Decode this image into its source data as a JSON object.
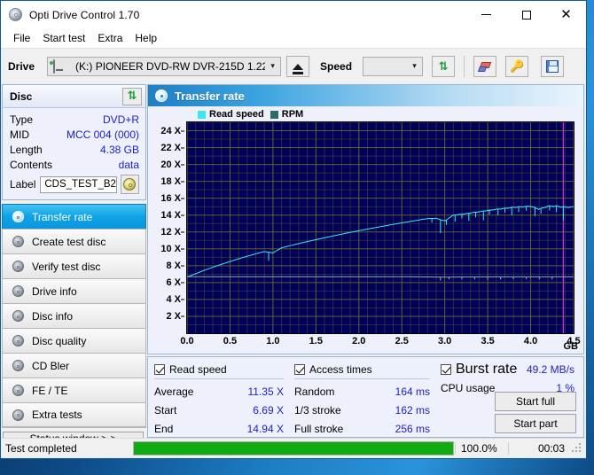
{
  "window": {
    "title": "Opti Drive Control 1.70",
    "app_icon": "disc-icon",
    "controls": {
      "minimize": "minimize-icon",
      "maximize": "maximize-icon",
      "close": "close-icon"
    }
  },
  "menubar": {
    "items": [
      "File",
      "Start test",
      "Extra",
      "Help"
    ]
  },
  "toolbar": {
    "drive_label": "Drive",
    "drive_value": "(K:)  PIONEER DVD-RW  DVR-215D 1.22",
    "eject_icon": "eject-icon",
    "speed_label": "Speed",
    "speed_value": "",
    "refresh_icon": "refresh-icon",
    "erase_icon": "eraser-icon",
    "tools_icon": "tools-icon",
    "save_icon": "save-icon"
  },
  "disc": {
    "header": "Disc",
    "refresh_icon": "refresh-icon",
    "rows": [
      {
        "key": "Type",
        "value": "DVD+R"
      },
      {
        "key": "MID",
        "value": "MCC 004 (000)"
      },
      {
        "key": "Length",
        "value": "4.38 GB"
      },
      {
        "key": "Contents",
        "value": "data"
      }
    ],
    "label_key": "Label",
    "label_value": "CDS_TEST_B2",
    "label_button_icon": "cd-icon"
  },
  "nav": {
    "items": [
      {
        "label": "Transfer rate",
        "icon": "disc-icon",
        "selected": true
      },
      {
        "label": "Create test disc",
        "icon": "disc-icon",
        "selected": false
      },
      {
        "label": "Verify test disc",
        "icon": "disc-icon",
        "selected": false
      },
      {
        "label": "Drive info",
        "icon": "disc-icon",
        "selected": false
      },
      {
        "label": "Disc info",
        "icon": "disc-icon",
        "selected": false
      },
      {
        "label": "Disc quality",
        "icon": "disc-icon",
        "selected": false
      },
      {
        "label": "CD Bler",
        "icon": "disc-icon",
        "selected": false
      },
      {
        "label": "FE / TE",
        "icon": "disc-icon",
        "selected": false
      },
      {
        "label": "Extra tests",
        "icon": "disc-icon",
        "selected": false
      }
    ],
    "status_window_button": "Status window > >"
  },
  "panel": {
    "title": "Transfer rate",
    "icon": "disc-icon"
  },
  "chart_data": {
    "type": "line",
    "title": "Transfer rate",
    "xlabel": "GB",
    "ylabel": "X",
    "xlim": [
      0.0,
      4.5
    ],
    "ylim": [
      0,
      25
    ],
    "xticks": [
      0.0,
      0.5,
      1.0,
      1.5,
      2.0,
      2.5,
      3.0,
      3.5,
      4.0,
      4.5
    ],
    "xticklabels": [
      "0.0",
      "0.5",
      "1.0",
      "1.5",
      "2.0",
      "2.5",
      "3.0",
      "3.5",
      "4.0",
      "4.5"
    ],
    "x_unit_label": "GB",
    "yticks": [
      2,
      4,
      6,
      8,
      10,
      12,
      14,
      16,
      18,
      20,
      22,
      24
    ],
    "yticklabels": [
      "2 X",
      "4 X",
      "6 X",
      "8 X",
      "10 X",
      "12 X",
      "14 X",
      "16 X",
      "18 X",
      "20 X",
      "22 X",
      "24 X"
    ],
    "grid": true,
    "background": "#00005a",
    "grid_color": "#6b6b1e",
    "legend_position": "top-left",
    "marker_line": {
      "x": 4.38,
      "color": "#cc33cc",
      "label": "disc end"
    },
    "series": [
      {
        "name": "Read speed",
        "color": "#3ce8f0",
        "x": [
          0.0,
          0.05,
          0.1,
          0.2,
          0.3,
          0.4,
          0.5,
          0.6,
          0.7,
          0.8,
          0.9,
          1.0,
          1.1,
          1.2,
          1.3,
          1.4,
          1.5,
          1.6,
          1.7,
          1.8,
          1.9,
          2.0,
          2.1,
          2.2,
          2.3,
          2.4,
          2.5,
          2.6,
          2.7,
          2.8,
          2.9,
          3.0,
          3.1,
          3.2,
          3.3,
          3.4,
          3.5,
          3.6,
          3.7,
          3.8,
          3.9,
          4.0,
          4.1,
          4.2,
          4.3,
          4.38
        ],
        "values": [
          6.69,
          6.85,
          7.05,
          7.45,
          7.82,
          8.16,
          8.5,
          8.82,
          9.12,
          9.41,
          9.68,
          9.52,
          10.12,
          10.38,
          10.62,
          10.86,
          11.09,
          11.31,
          11.53,
          11.74,
          11.95,
          12.15,
          12.34,
          12.53,
          12.72,
          12.9,
          13.08,
          13.25,
          13.42,
          13.59,
          13.62,
          13.3,
          14.0,
          14.1,
          14.25,
          14.4,
          14.55,
          14.68,
          14.8,
          14.92,
          14.99,
          15.05,
          14.7,
          15.05,
          15.06,
          14.94
        ]
      },
      {
        "name": "RPM",
        "color": "#8fb0b0",
        "x": [
          0.0,
          0.5,
          1.0,
          1.5,
          2.0,
          2.5,
          3.0,
          3.5,
          4.0,
          4.38
        ],
        "values": [
          6.7,
          6.7,
          6.7,
          6.7,
          6.7,
          6.7,
          6.65,
          6.68,
          6.68,
          6.68
        ]
      }
    ]
  },
  "stats": {
    "read_speed": {
      "checkbox_label": "Read speed",
      "checked": true,
      "rows": [
        {
          "key": "Average",
          "value": "11.35 X"
        },
        {
          "key": "Start",
          "value": "6.69 X"
        },
        {
          "key": "End",
          "value": "14.94 X"
        }
      ]
    },
    "access_times": {
      "checkbox_label": "Access times",
      "checked": true,
      "rows": [
        {
          "key": "Random",
          "value": "164 ms"
        },
        {
          "key": "1/3 stroke",
          "value": "162 ms"
        },
        {
          "key": "Full stroke",
          "value": "256 ms"
        }
      ]
    },
    "burst": {
      "checkbox_label": "Burst rate",
      "checked": true,
      "burst_value": "49.2 MB/s",
      "rows": [
        {
          "key": "CPU usage",
          "value": "1 %"
        }
      ]
    },
    "buttons": [
      "Start full",
      "Start part"
    ]
  },
  "statusbar": {
    "message": "Test completed",
    "progress_percent": 100.0,
    "progress_text": "100.0%",
    "elapsed": "00:03",
    "progress_color": "#10ab10"
  }
}
